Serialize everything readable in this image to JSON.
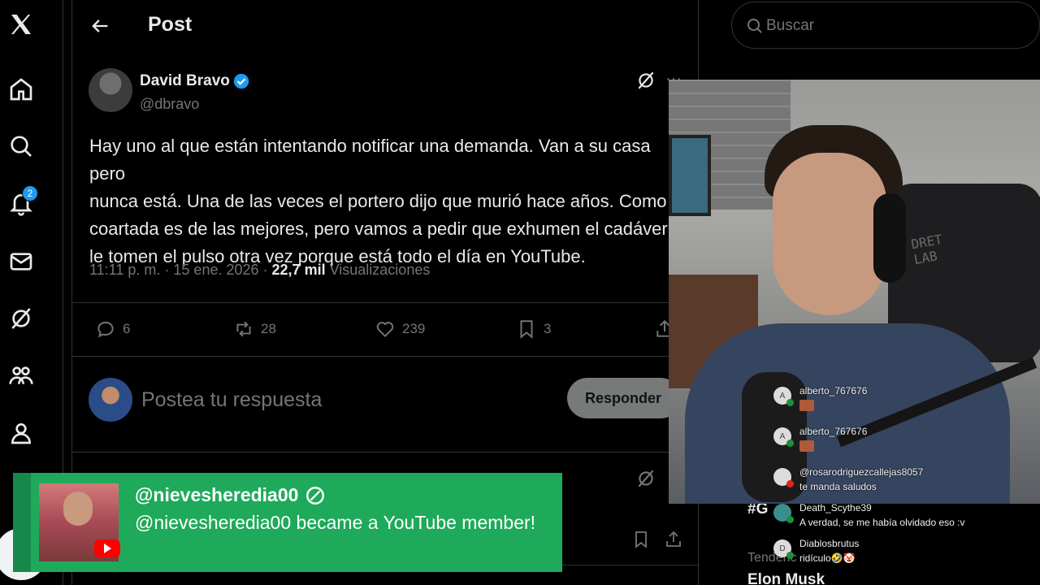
{
  "nav": {
    "logo_icon": "x-logo-icon",
    "items": [
      "home-icon",
      "search-icon",
      "bell-icon",
      "mail-icon",
      "grok-icon",
      "communities-icon",
      "profile-icon"
    ],
    "notifications_badge": "2"
  },
  "post": {
    "header_title": "Post",
    "author": {
      "name": "David Bravo",
      "handle": "@dbravo",
      "verified": true
    },
    "text": "Hay uno al que están intentando notificar una demanda. Van a su casa pero\nnunca está. Una de las veces el portero dijo que murió hace años. Como\ncoartada es de las mejores, pero vamos a pedir que exhumen el cadáver y\nle tomen el pulso otra vez porque está todo el día en YouTube.",
    "time": "11:11 p. m.",
    "date": "15 ene. 2026",
    "views_count": "22,7 mil",
    "views_label": "Visualizaciones",
    "actions": {
      "replies": "6",
      "reposts": "28",
      "likes": "239",
      "bookmarks": "3"
    }
  },
  "reply_box": {
    "placeholder": "Postea tu respuesta",
    "button_label": "Responder"
  },
  "sidebar": {
    "search_placeholder": "Buscar",
    "trend_hashtag": "#G",
    "trends_label": "Tendenc",
    "trend_name": "Elon Musk"
  },
  "webcam": {
    "chair_brand": "DRET\nLAB"
  },
  "chat": [
    {
      "user": "alberto_767676",
      "message": "",
      "avatar": "A",
      "emote": true
    },
    {
      "user": "alberto_767676",
      "message": "",
      "avatar": "A",
      "emote": true
    },
    {
      "user": "@rosarodriguezcallejas8057",
      "message": "te manda saludos",
      "avatar": "",
      "emote": false
    },
    {
      "user": "Death_Scythe39",
      "message": "A verdad, se me había olvidado eso :v",
      "avatar": "",
      "emote": false
    },
    {
      "user": "Diablosbrutus",
      "message": "ridículo🤣🤡",
      "avatar": "D",
      "emote": false
    }
  ],
  "member_alert": {
    "name": "@nievesheredia00",
    "message": "@nievesheredia00 became a YouTube member!",
    "color": "#1eaa5a"
  },
  "colors": {
    "accent": "#1d9bf0",
    "muted": "#71767b",
    "text": "#e7e9ea"
  }
}
